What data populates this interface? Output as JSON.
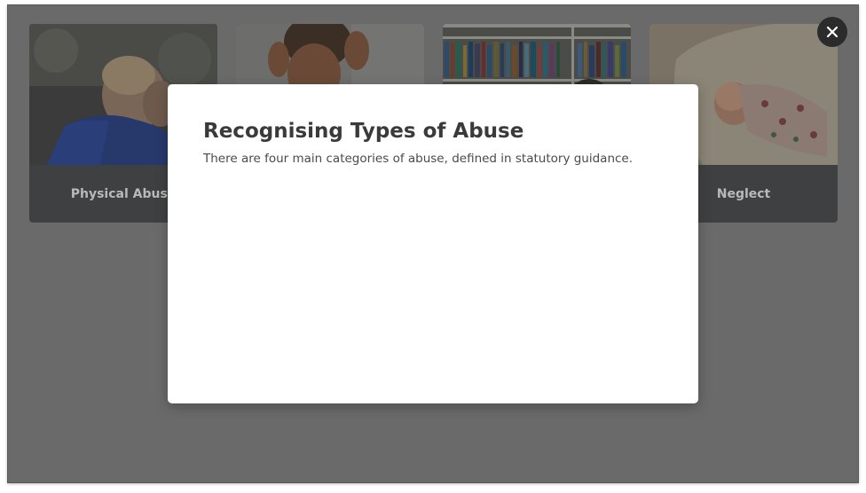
{
  "background_cards": [
    {
      "label": "Physical Abuse",
      "image": "man-with-head-in-hands-photo"
    },
    {
      "label": "",
      "image": "crying-child-covering-ears-photo"
    },
    {
      "label": "",
      "image": "bookshelf-photo"
    },
    {
      "label": "Neglect",
      "image": "crying-baby-in-cot-photo"
    }
  ],
  "modal": {
    "title": "Recognising Types of Abuse",
    "subtitle": "There are four main categories of abuse, defined in statutory guidance."
  },
  "close_button": {
    "icon": "close-icon"
  },
  "colors": {
    "overlay": "#6a6a6a",
    "card_footer": "#3f4042",
    "card_label": "#b9b9b9",
    "modal_bg": "#ffffff",
    "title_text": "#3a3a3a",
    "close_bg": "#2b2b2b"
  }
}
